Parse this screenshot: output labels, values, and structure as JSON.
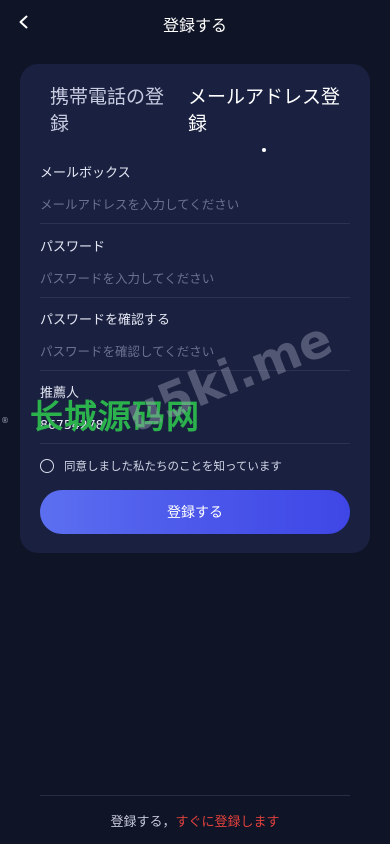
{
  "header": {
    "title": "登録する",
    "back_icon": "chevron-left-icon"
  },
  "tabs": {
    "phone_label": "携帯電話の登録",
    "email_label": "メールアドレス登録",
    "active": "email"
  },
  "fields": {
    "mailbox": {
      "label": "メールボックス",
      "placeholder": "メールアドレスを入力してください",
      "value": ""
    },
    "password": {
      "label": "パスワード",
      "placeholder": "パスワードを入力してください",
      "value": ""
    },
    "confirm": {
      "label": "パスワードを確認する",
      "placeholder": "パスワードを確認してください",
      "value": ""
    },
    "referrer": {
      "label": "推薦人",
      "value": "86754278"
    }
  },
  "agreement": {
    "text": "同意しました私たちのことを知っています",
    "checked": false
  },
  "submit_label": "登録する",
  "footer": {
    "prefix": "登録する，",
    "link": "すぐに登録します"
  },
  "watermark": {
    "text": "长城源码网",
    "latin": "u5ki.me",
    "mark": "®"
  },
  "colors": {
    "background": "#0f1427",
    "card": "#1a2040",
    "accent": "#4a56ea",
    "link": "#e0413c"
  }
}
